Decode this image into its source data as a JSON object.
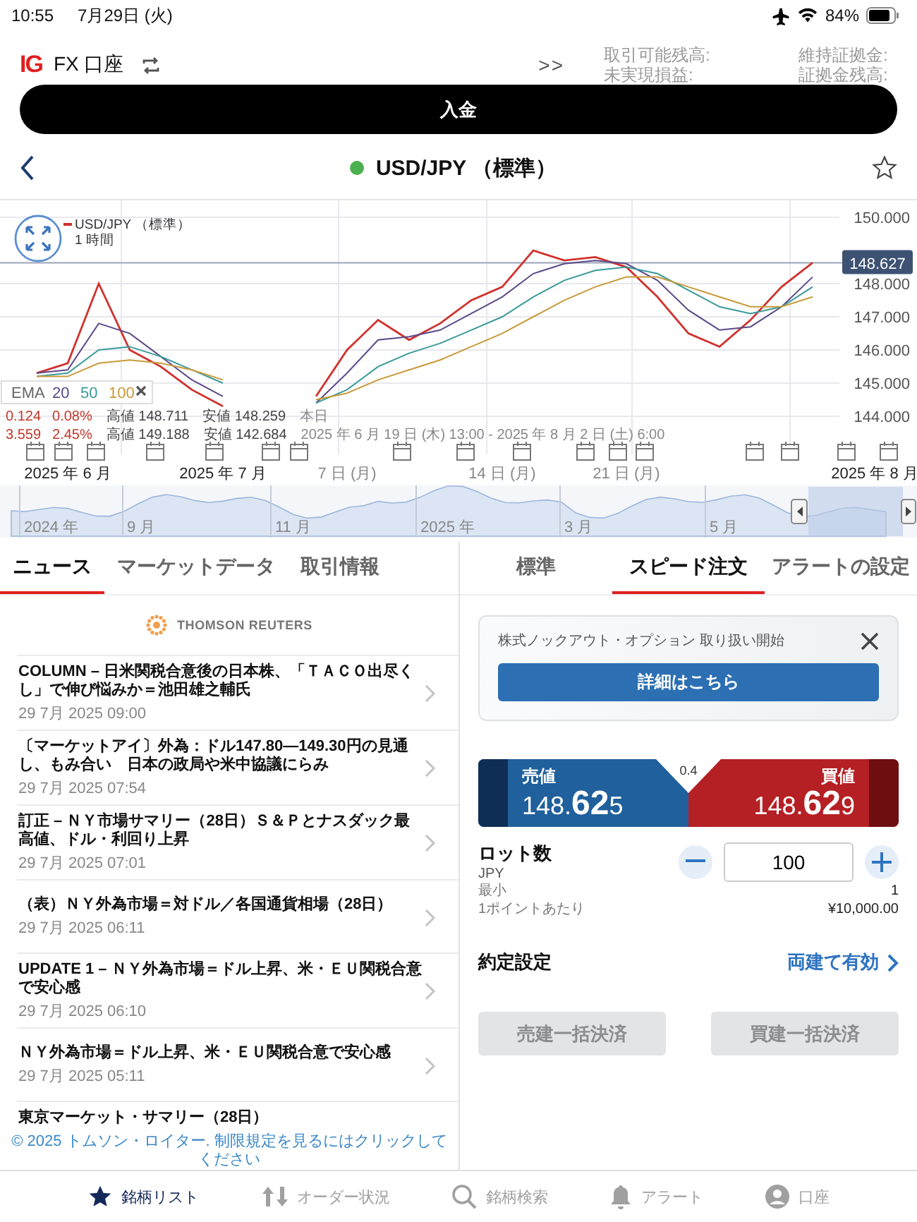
{
  "status_bar": {
    "time": "10:55",
    "date": "7月29日 (火)",
    "battery": "84%"
  },
  "account_header": {
    "logo": "IG",
    "account": "FX 口座",
    "more": ">>",
    "labels": [
      "取引可能残高:",
      "未実現損益:",
      "維持証拠金:",
      "証拠金残高:"
    ]
  },
  "deposit_button": "入金",
  "instrument": {
    "name": "USD/JPY （標準）",
    "market_open": true,
    "favorite": false
  },
  "chart": {
    "interval": "1 時間",
    "legend": {
      "label": "EMA"
    },
    "stats": [
      {
        "change": "0.124",
        "pct": "0.08%",
        "high_label": "高値",
        "high": "148.711",
        "low_label": "安値",
        "low": "148.259",
        "range": "本日"
      },
      {
        "change": "3.559",
        "pct": "2.45%",
        "high_label": "高値",
        "high": "149.188",
        "low_label": "安値",
        "low": "142.684",
        "range": "2025 年 6 月 19 日 (木) 13:00 - 2025 年 8 月 2 日 (土) 6:00"
      }
    ],
    "chart_data": {
      "type": "line",
      "categories": [
        null,
        "2025 年 6 月",
        null,
        null,
        null,
        null,
        "2025 年 7 月",
        null,
        null,
        null,
        "7 日 (月)",
        null,
        null,
        null,
        null,
        "14 日 (月)",
        null,
        null,
        null,
        "21 日 (月)",
        null,
        null,
        null,
        null,
        null,
        null,
        null,
        "2025 年 8 月"
      ],
      "grid": true,
      "ylim": [
        144,
        150
      ],
      "ref_lines": [
        {
          "axis": "y",
          "value": 148.627,
          "label": "148.627",
          "color": "#9aa3b8"
        }
      ],
      "yticks": [
        {
          "value": 144,
          "label": "144.000"
        },
        {
          "value": 145,
          "label": "145.000"
        },
        {
          "value": 146,
          "label": "146.000"
        },
        {
          "value": 147,
          "label": "147.000"
        },
        {
          "value": 148,
          "label": "148.000"
        },
        {
          "value": 150,
          "label": "150.000"
        }
      ],
      "series": [
        {
          "name": "USD/JPY （標準）",
          "color": "#d0312d",
          "values": [
            145.3,
            145.6,
            148.0,
            146.0,
            145.5,
            144.8,
            144.3,
            null,
            null,
            144.6,
            146.0,
            146.9,
            146.3,
            146.8,
            147.5,
            147.9,
            149.0,
            148.7,
            148.8,
            148.5,
            147.6,
            146.5,
            146.1,
            146.9,
            147.9,
            148.63,
            null,
            null
          ]
        },
        {
          "name": "20",
          "color": "#5b4a8a",
          "values": [
            145.3,
            145.4,
            146.8,
            146.5,
            145.8,
            145.1,
            144.6,
            null,
            null,
            144.4,
            145.3,
            146.3,
            146.4,
            146.6,
            147.1,
            147.6,
            148.3,
            148.6,
            148.7,
            148.6,
            148.1,
            147.2,
            146.6,
            146.7,
            147.3,
            148.2,
            null,
            null
          ]
        },
        {
          "name": "50",
          "color": "#3a9a9a",
          "values": [
            145.2,
            145.3,
            146.0,
            146.1,
            145.8,
            145.4,
            145.0,
            null,
            null,
            144.4,
            144.8,
            145.5,
            145.9,
            146.2,
            146.6,
            147.0,
            147.6,
            148.1,
            148.4,
            148.5,
            148.3,
            147.8,
            147.3,
            147.1,
            147.3,
            147.9,
            null,
            null
          ]
        },
        {
          "name": "100",
          "color": "#c99a3a",
          "values": [
            145.2,
            145.2,
            145.6,
            145.7,
            145.6,
            145.4,
            145.1,
            null,
            null,
            144.5,
            144.7,
            145.1,
            145.4,
            145.7,
            146.1,
            146.5,
            147.0,
            147.5,
            147.9,
            148.2,
            148.2,
            147.9,
            147.6,
            147.3,
            147.3,
            147.6,
            null,
            null
          ]
        }
      ]
    }
  },
  "navigator": {
    "labels": [
      "2024 年",
      "9 月",
      "11 月",
      "2025 年",
      "3 月",
      "5 月"
    ]
  },
  "news_tabs": [
    {
      "label": "ニュース",
      "selected": true
    },
    {
      "label": "マーケットデータ",
      "selected": false
    },
    {
      "label": "取引情報",
      "selected": false
    }
  ],
  "news_source": "THOMSON REUTERS",
  "news": [
    {
      "title": "COLUMN – 日米関税合意後の日本株、「ＴＡＣＯ出尽くし」で伸び悩みか＝池田雄之輔氏",
      "date": "29 7月 2025 09:00"
    },
    {
      "title": "〔マーケットアイ〕外為：ドル147.80―149.30円の見通し、もみ合い　日本の政局や米中協議にらみ",
      "date": "29 7月 2025 07:54"
    },
    {
      "title": "訂正 – ＮＹ市場サマリー（28日）Ｓ＆Ｐとナスダック最高値、ドル・利回り上昇",
      "date": "29 7月 2025 07:01"
    },
    {
      "title": "（表）ＮＹ外為市場＝対ドル／各国通貨相場（28日）",
      "date": "29 7月 2025 06:11"
    },
    {
      "title": "UPDATE 1 – ＮＹ外為市場＝ドル上昇、米・ＥＵ関税合意で安心感",
      "date": "29 7月 2025 06:10"
    },
    {
      "title": "ＮＹ外為市場＝ドル上昇、米・ＥＵ関税合意で安心感",
      "date": "29 7月 2025 05:11"
    },
    {
      "title": "東京マーケット・サマリー（28日）"
    }
  ],
  "news_footer": "© 2025 トムソン・ロイター. 制限規定を見るにはクリックしてください",
  "order_tabs": [
    {
      "label": "標準",
      "selected": false
    },
    {
      "label": "スピード注文",
      "selected": true
    },
    {
      "label": "アラートの設定",
      "selected": false
    }
  ],
  "banner": {
    "text": "株式ノックアウト・オプション 取り扱い開始",
    "button": "詳細はこちら"
  },
  "quote": {
    "spread": "0.4",
    "sell": {
      "label": "売値",
      "head": "148.",
      "big": "62",
      "tail": "5"
    },
    "buy": {
      "label": "買値",
      "head": "148.",
      "big": "62",
      "tail": "9"
    }
  },
  "lot": {
    "label": "ロット数",
    "currency": "JPY",
    "value": "100",
    "min_label": "最小",
    "min": "1",
    "per_point_label": "1ポイントあたり",
    "per_point": "¥10,000.00"
  },
  "execution": {
    "label": "約定設定",
    "value": "両建て有効"
  },
  "close_buttons": [
    {
      "label": "売建一括決済",
      "disabled": true
    },
    {
      "label": "買建一括決済",
      "disabled": true
    }
  ],
  "bottom_nav": [
    {
      "kind": "star",
      "label": "銘柄リスト",
      "selected": true
    },
    {
      "kind": "orders",
      "label": "オーダー状況",
      "selected": false
    },
    {
      "kind": "search",
      "label": "銘柄検索",
      "selected": false
    },
    {
      "kind": "bell",
      "label": "アラート",
      "selected": false
    },
    {
      "kind": "account",
      "label": "口座",
      "selected": false
    }
  ]
}
